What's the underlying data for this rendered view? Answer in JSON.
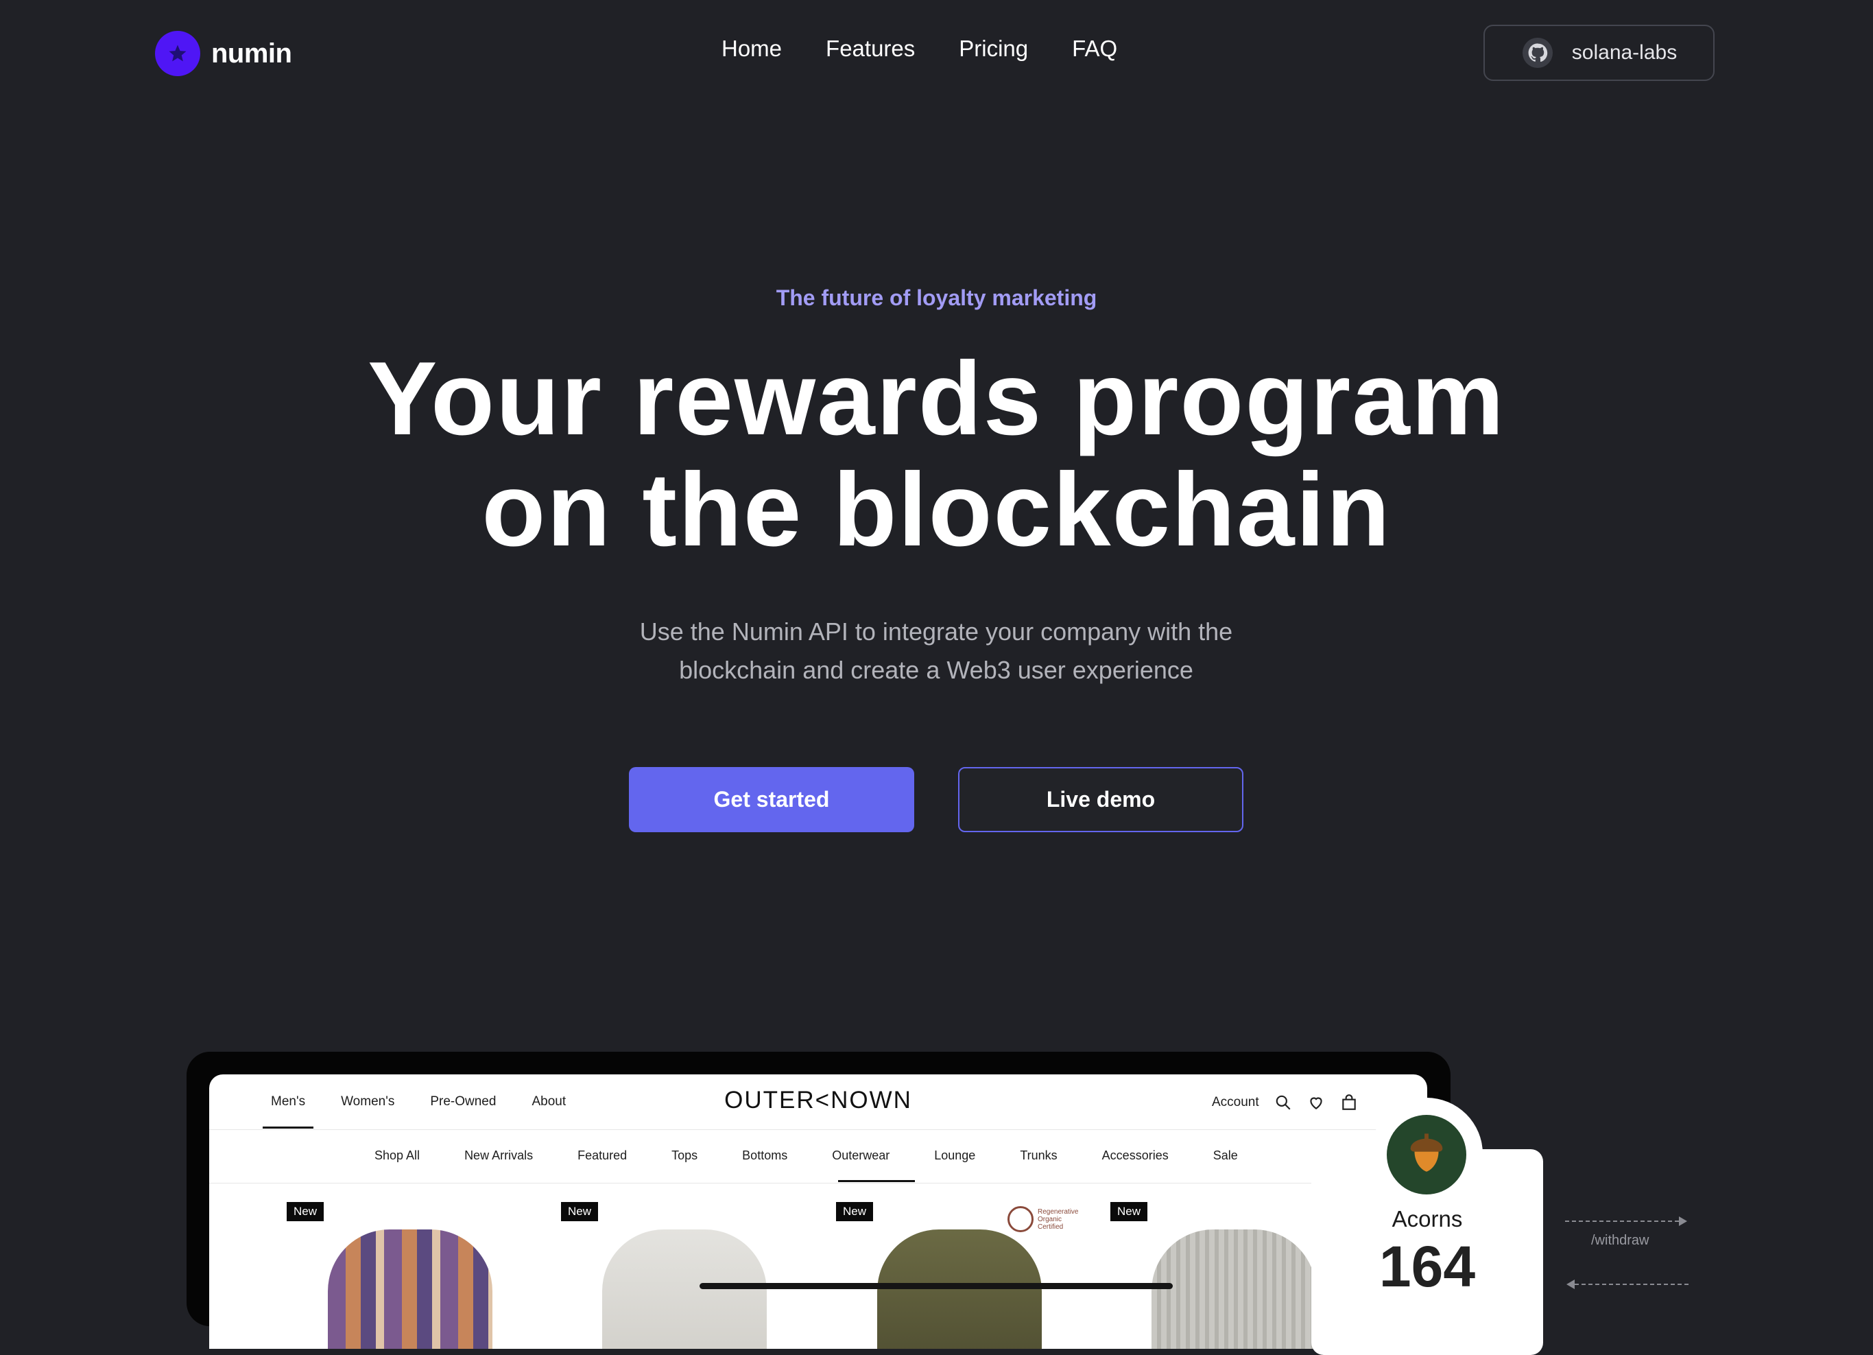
{
  "brand": {
    "name": "numin",
    "color": "#4f16f5",
    "icon": "star-icon"
  },
  "nav": {
    "links": [
      "Home",
      "Features",
      "Pricing",
      "FAQ"
    ]
  },
  "github_button": {
    "label": "solana-labs",
    "icon": "github-icon"
  },
  "hero": {
    "eyebrow": "The future of loyalty marketing",
    "headline_line1": "Your rewards program",
    "headline_line2": "on the blockchain",
    "subtext": "Use the Numin API to integrate your company with the blockchain and create a Web3 user experience",
    "accent_color": "#6366ee"
  },
  "cta": {
    "primary": "Get started",
    "secondary": "Live demo"
  },
  "demo_store": {
    "brand": "OUTER<NOWN",
    "top_links": [
      "Men's",
      "Women's",
      "Pre-Owned",
      "About"
    ],
    "active_top_link": "Men's",
    "account_label": "Account",
    "icons": [
      "search-icon",
      "heart-icon",
      "bag-icon"
    ],
    "categories": [
      "Shop All",
      "New Arrivals",
      "Featured",
      "Tops",
      "Bottoms",
      "Outerwear",
      "Lounge",
      "Trunks",
      "Accessories",
      "Sale"
    ],
    "active_category": "Outerwear",
    "badges": [
      "New",
      "New",
      "New",
      "New"
    ],
    "organic_label": "Regenerative Organic Certified"
  },
  "rewards_card": {
    "label": "Acorns",
    "value": "164",
    "icon": "acorn-icon"
  },
  "flow": {
    "withdraw_label": "/withdraw"
  }
}
